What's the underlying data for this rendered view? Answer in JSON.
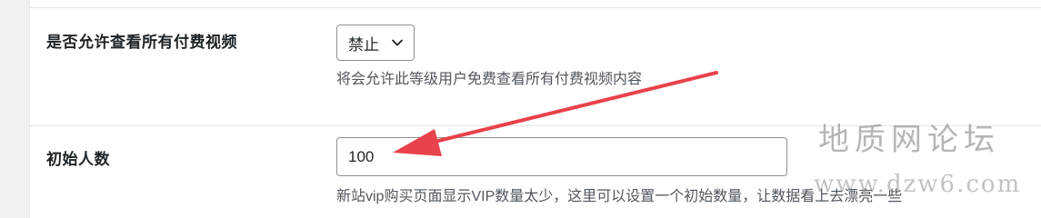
{
  "settings": {
    "paid_video_access": {
      "label": "是否允许查看所有付费视频",
      "selected_value": "禁止",
      "description": "将会允许此等级用户免费查看所有付费视频内容"
    },
    "initial_count": {
      "label": "初始人数",
      "value": "100",
      "description": "新站vip购买页面显示VIP数量太少，这里可以设置一个初始数量，让数据看上去漂亮一些"
    }
  },
  "watermark": {
    "title": "地质网论坛",
    "url": "www.dzw6.com"
  },
  "colors": {
    "annotation_arrow": "#e8424a"
  },
  "icons": {
    "select_chevron": "chevron-down-icon"
  }
}
